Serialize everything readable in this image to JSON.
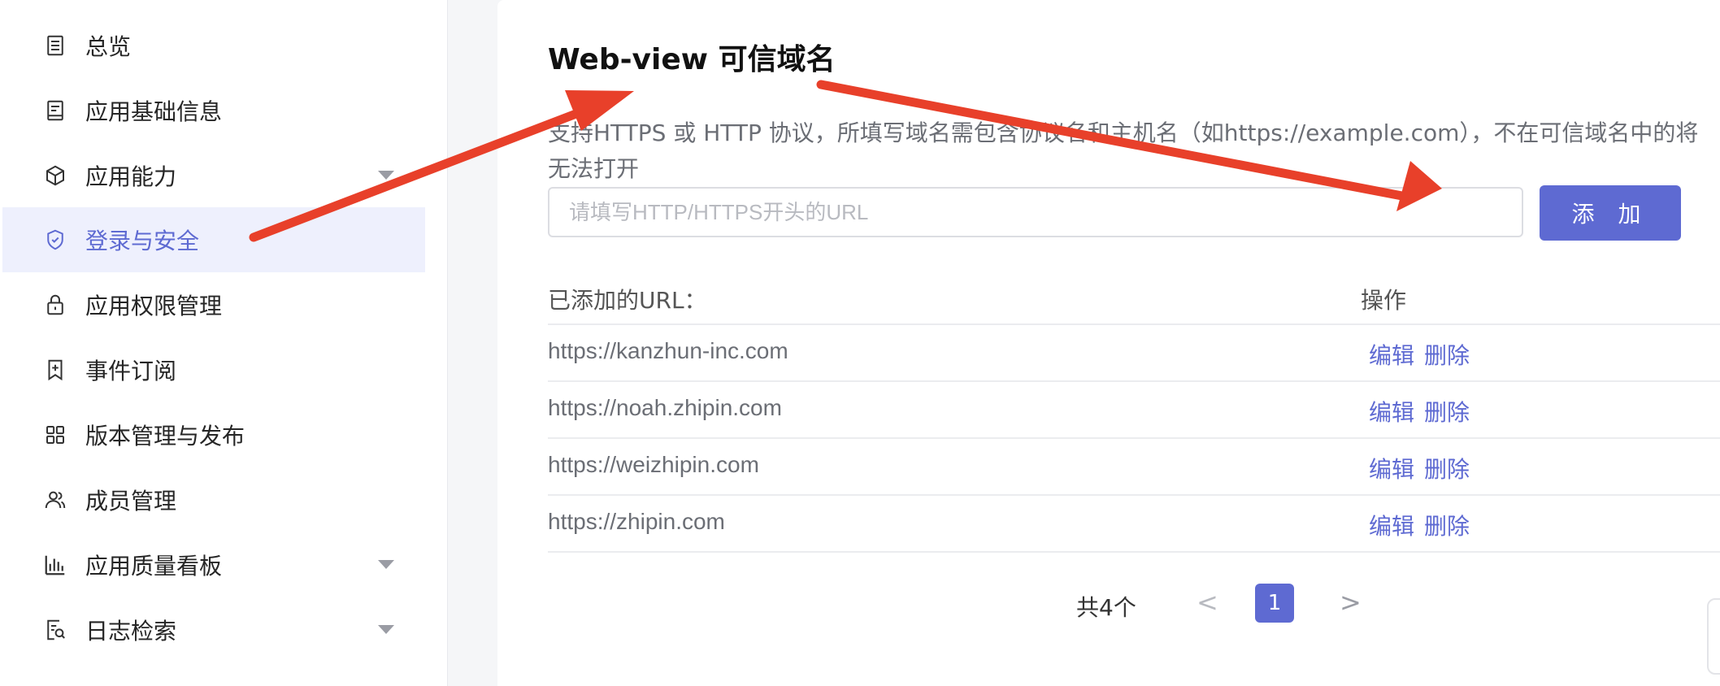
{
  "sidebar": {
    "items": [
      {
        "label": "总览",
        "icon": "list-doc-icon",
        "caret": false,
        "active": false
      },
      {
        "label": "应用基础信息",
        "icon": "document-icon",
        "caret": false,
        "active": false
      },
      {
        "label": "应用能力",
        "icon": "cube-icon",
        "caret": true,
        "active": false
      },
      {
        "label": "登录与安全",
        "icon": "shield-icon",
        "caret": false,
        "active": true
      },
      {
        "label": "应用权限管理",
        "icon": "lock-icon",
        "caret": false,
        "active": false
      },
      {
        "label": "事件订阅",
        "icon": "bookmark-plus-icon",
        "caret": false,
        "active": false
      },
      {
        "label": "版本管理与发布",
        "icon": "grid-icon",
        "caret": false,
        "active": false
      },
      {
        "label": "成员管理",
        "icon": "users-icon",
        "caret": false,
        "active": false
      },
      {
        "label": "应用质量看板",
        "icon": "bar-chart-icon",
        "caret": true,
        "active": false
      },
      {
        "label": "日志检索",
        "icon": "search-doc-icon",
        "caret": true,
        "active": false
      }
    ]
  },
  "main": {
    "title": "Web-view 可信域名",
    "description": "支持HTTPS 或 HTTP 协议，所填写域名需包含协议名和主机名（如https://example.com），不在可信域名中的将无法打开",
    "input": {
      "placeholder": "请填写HTTP/HTTPS开头的URL",
      "value": ""
    },
    "add_label": "添 加",
    "table": {
      "header_url": "已添加的URL：",
      "header_ops": "操作",
      "edit_label": "编辑",
      "delete_label": "删除",
      "rows": [
        "https://kanzhun-inc.com",
        "https://noah.zhipin.com",
        "https://weizhipin.com",
        "https://zhipin.com"
      ]
    },
    "pagination": {
      "total": "共4个",
      "prev": "<",
      "current": "1",
      "next": ">"
    }
  },
  "colors": {
    "accent": "#5e6ad2",
    "annotation_arrow": "#e8402a"
  }
}
